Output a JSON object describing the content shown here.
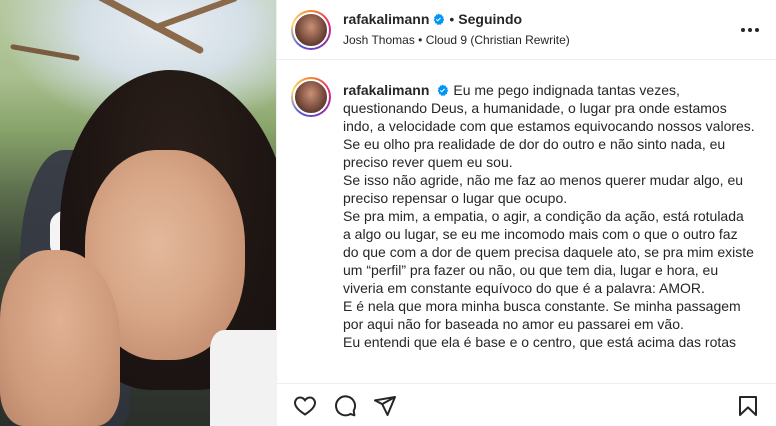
{
  "post": {
    "username": "rafakalimann",
    "follow_status": "Seguindo",
    "separator": "•",
    "audio_artist": "Josh Thomas",
    "audio_separator": "•",
    "audio_track": "Cloud 9 (Christian Rewrite)",
    "verified": true
  },
  "caption": {
    "username": "rafakalimann",
    "lines": [
      "Eu me pego indignada tantas vezes, questionando Deus, a humanidade, o lugar pra onde estamos indo, a velocidade com que estamos equivocando nossos valores.",
      "Se eu olho pra realidade de dor do outro e não sinto nada, eu preciso rever quem eu sou.",
      "Se isso não agride, não me faz ao menos querer mudar algo, eu preciso repensar o lugar que ocupo.",
      "Se pra mim, a empatia, o agir, a condição da ação, está rotulada a algo ou lugar, se eu me incomodo mais com o que o outro faz do que com a dor de quem precisa daquele ato, se pra mim existe um “perfil” pra fazer ou não, ou que tem dia, lugar e hora, eu viveria em constante equívoco do que é a palavra: AMOR.",
      "E é nela que mora minha busca constante. Se minha passagem por aqui não for baseada no amor eu passarei em vão.",
      "Eu entendi que ela é base e o centro, que está acima das rotas"
    ]
  },
  "icons": {
    "like": "heart-icon",
    "comment": "comment-icon",
    "share": "paper-plane-icon",
    "save": "bookmark-icon",
    "more": "more-options-icon",
    "verified": "verified-badge-icon"
  },
  "colors": {
    "verified_blue": "#0095f6",
    "text": "#262626",
    "divider": "#efefef"
  }
}
